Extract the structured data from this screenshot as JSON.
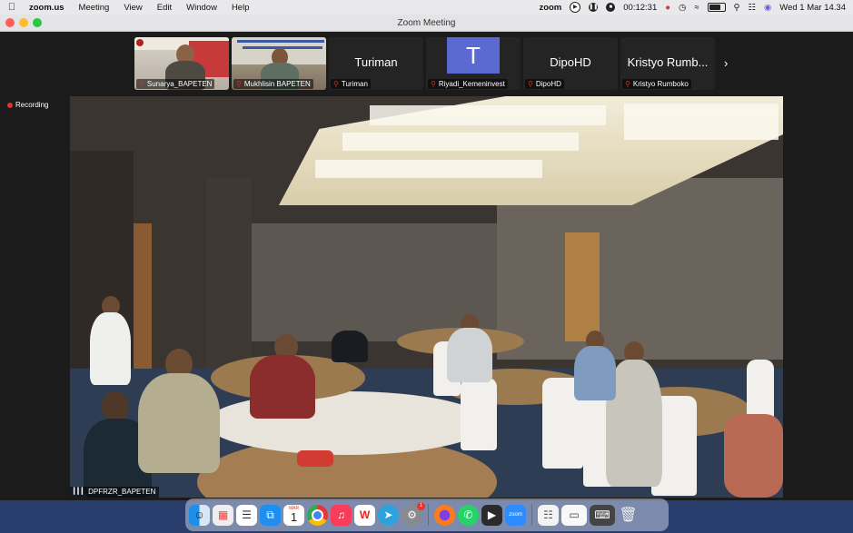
{
  "menubar": {
    "app_name": "zoom.us",
    "menus": [
      "Meeting",
      "View",
      "Edit",
      "Window",
      "Help"
    ],
    "zoom_label": "zoom",
    "timer": "00:12:31",
    "datetime": "Wed 1 Mar  14.34"
  },
  "window": {
    "title": "Zoom Meeting"
  },
  "gallery": [
    {
      "name": "Sunarya_BAPETEN",
      "type": "video"
    },
    {
      "name": "Mukhlisin BAPETEN",
      "type": "video"
    },
    {
      "name": "Turiman",
      "display": "Turiman",
      "type": "name"
    },
    {
      "name": "Riyadi_Kemeninvest",
      "display": "T",
      "type": "avatar"
    },
    {
      "name": "DipoHD",
      "display": "DipoHD",
      "type": "name"
    },
    {
      "name": "Kristyo Rumboko",
      "display": "Kristyo Rumb...",
      "type": "name"
    }
  ],
  "recording_label": "Recording",
  "main_video": {
    "participant": "DPFRZR_BAPETEN"
  },
  "dock": {
    "calendar_month": "MAR",
    "calendar_day": "1",
    "badge_count": "1",
    "apps": [
      "finder",
      "launchpad",
      "reminders",
      "safari",
      "calendar",
      "chrome",
      "music",
      "wps-office",
      "telegram",
      "system-settings",
      "firefox",
      "whatsapp",
      "facetime",
      "zoom",
      "preview",
      "screenshot",
      "keyboard",
      "trash"
    ],
    "zoom_text": "zoom"
  },
  "colors": {
    "menubar_bg": "#e9e9ec",
    "window_bg": "#1b1b1b",
    "avatar_bg": "#5a6ad1",
    "recording_dot": "#e0332c",
    "mic_muted": "#e02828"
  }
}
